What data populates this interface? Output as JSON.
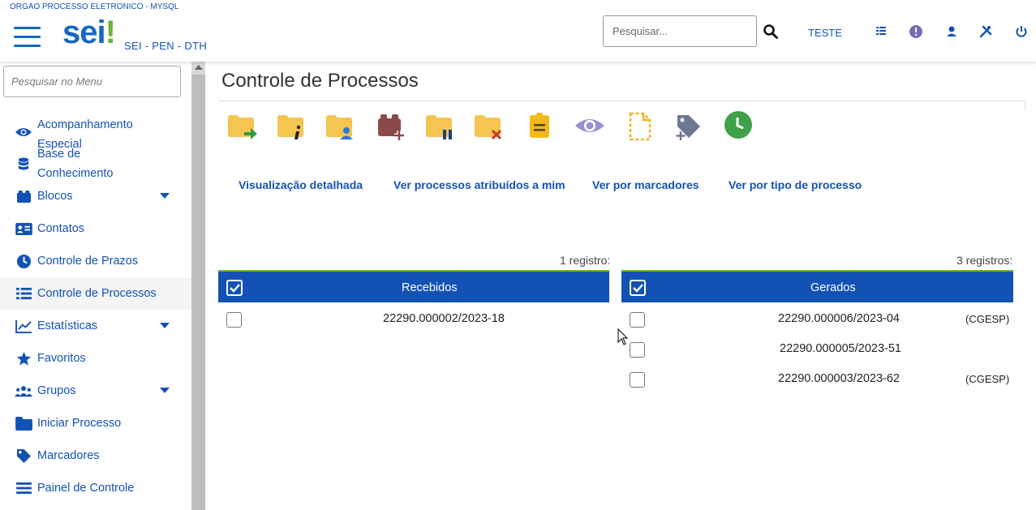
{
  "header": {
    "org_title": "ORGAO PROCESSO ELETRONICO - MYSQL",
    "logo_text": "sei",
    "logo_bang": "!",
    "system_name": "SEI - PEN - DTH",
    "search_placeholder": "Pesquisar...",
    "unit_label": "TESTE",
    "icons": [
      "search-icon",
      "grid-list-icon",
      "info-exclamation-icon",
      "user-icon",
      "tools-icon",
      "power-icon"
    ]
  },
  "sidebar": {
    "search_placeholder": "Pesquisar no Menu",
    "items": [
      {
        "label": "Acompanhamento Especial",
        "icon": "eye-icon",
        "has_caret": false
      },
      {
        "label": "Base de Conhecimento",
        "icon": "database-icon",
        "has_caret": false
      },
      {
        "label": "Blocos",
        "icon": "blocks-icon",
        "has_caret": true
      },
      {
        "label": "Contatos",
        "icon": "contact-card-icon",
        "has_caret": false
      },
      {
        "label": "Controle de Prazos",
        "icon": "clock-icon",
        "has_caret": false
      },
      {
        "label": "Controle de Processos",
        "icon": "list-icon",
        "has_caret": false
      },
      {
        "label": "Estatísticas",
        "icon": "chart-line-icon",
        "has_caret": true
      },
      {
        "label": "Favoritos",
        "icon": "star-icon",
        "has_caret": false
      },
      {
        "label": "Grupos",
        "icon": "users-icon",
        "has_caret": true
      },
      {
        "label": "Iniciar Processo",
        "icon": "folder-icon",
        "has_caret": false
      },
      {
        "label": "Marcadores",
        "icon": "tag-icon",
        "has_caret": false
      },
      {
        "label": "Painel de Controle",
        "icon": "panel-icon",
        "has_caret": false
      }
    ]
  },
  "main": {
    "title": "Controle de Processos",
    "toolbar_icons": [
      "send-process-icon",
      "process-info-icon",
      "assign-process-icon",
      "add-to-block-icon",
      "suspend-process-icon",
      "close-process-icon",
      "annotation-icon",
      "mark-as-unread-icon",
      "new-document-icon",
      "add-marker-icon",
      "control-deadline-icon"
    ],
    "view_links": [
      "Visualização detalhada",
      "Ver processos atribuídos a mim",
      "Ver por marcadores",
      "Ver por tipo de processo"
    ],
    "received": {
      "count": "1 registro:",
      "header": "Recebidos",
      "rows": [
        {
          "number": "22290.000002/2023-18",
          "unit": ""
        }
      ]
    },
    "generated": {
      "count": "3 registros:",
      "header": "Gerados",
      "rows": [
        {
          "number": "22290.000006/2023-04",
          "unit": "(CGESP)"
        },
        {
          "number": "22290.000005/2023-51",
          "unit": ""
        },
        {
          "number": "22290.000003/2023-62",
          "unit": "(CGESP)"
        }
      ]
    }
  },
  "colors": {
    "primary": "#1352b4",
    "accent_green": "#6bb23a",
    "folder_yellow": "#f5c451",
    "sidebar_scroll": "#d8d8d8"
  }
}
